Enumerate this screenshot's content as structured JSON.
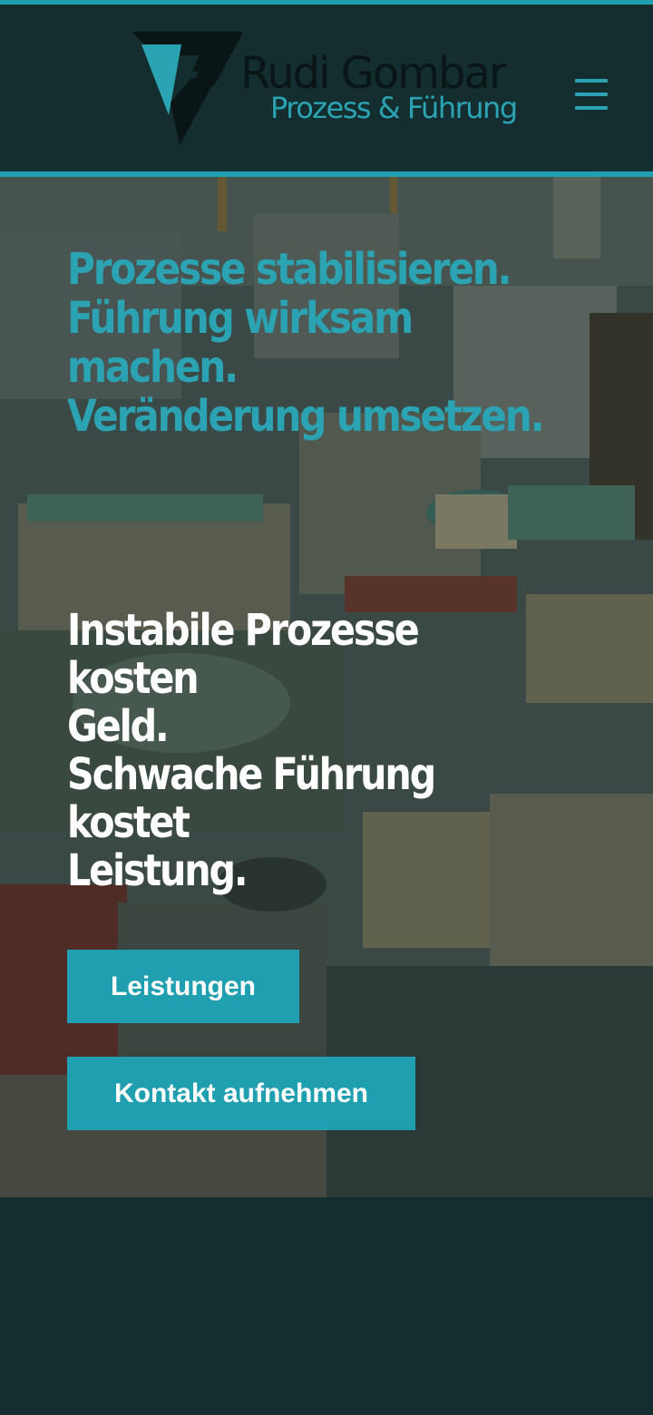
{
  "brand": {
    "name": "Rudi Gombar",
    "tagline": "Prozess & Führung",
    "accent_color": "#1f9fb0",
    "dark_color": "#142d2e"
  },
  "header": {
    "menu_icon": "hamburger-menu-icon"
  },
  "hero": {
    "headline_lines": [
      "Prozesse stabilisieren.",
      "Führung wirksam",
      "machen.",
      "Veränderung umsetzen."
    ],
    "sub_lines": [
      "Instabile Prozesse kosten",
      "Geld.",
      "Schwache Führung kostet",
      "Leistung."
    ],
    "buttons": {
      "services": "Leistungen",
      "contact": "Kontakt aufnehmen"
    }
  }
}
